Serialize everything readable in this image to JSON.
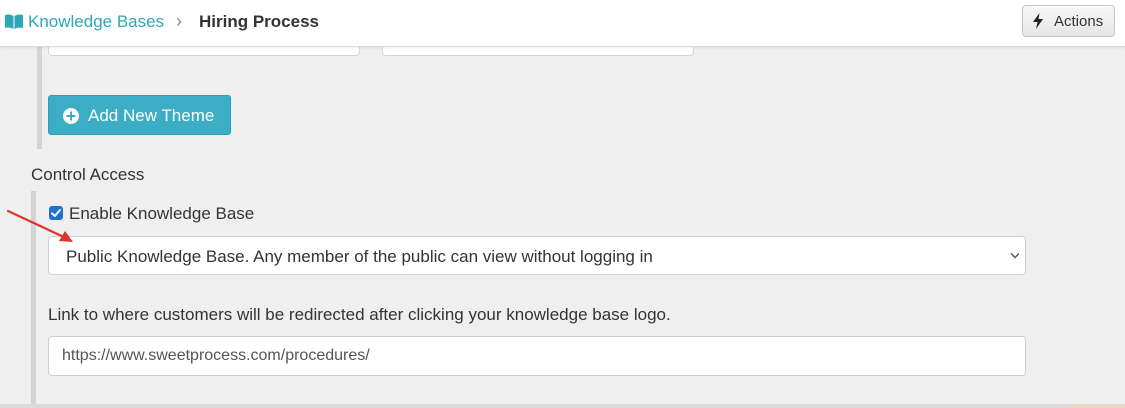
{
  "breadcrumb": {
    "icon": "book-icon",
    "parent_label": "Knowledge Bases",
    "separator": "›",
    "current_label": "Hiring Process"
  },
  "header": {
    "actions_label": "Actions",
    "actions_icon": "bolt-icon"
  },
  "themes": {
    "add_button_label": "Add New Theme",
    "add_button_icon": "plus-circle-icon"
  },
  "control_access": {
    "heading": "Control Access",
    "enable_checkbox_label": "Enable Knowledge Base",
    "enable_checked": true,
    "visibility_selected": "Public Knowledge Base. Any member of the public can view without logging in",
    "logo_link_help": "Link to where customers will be redirected after clicking your knowledge base logo.",
    "logo_link_value": "https://www.sweetprocess.com/procedures/"
  },
  "colors": {
    "link": "#2ea7b8",
    "primary_button": "#3badc4",
    "checkbox": "#1f6fd1",
    "annotation_arrow": "#e0332b",
    "background": "#efefef"
  }
}
